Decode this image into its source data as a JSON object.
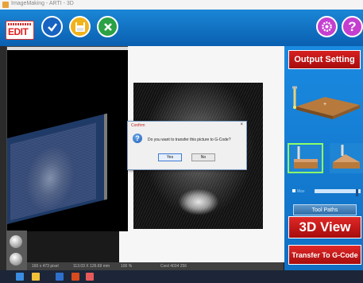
{
  "window": {
    "title": "ImageMaking - ARTI - 3D"
  },
  "toolbar": {
    "edit_label": "EDIT",
    "ok_icon": "checkmark-icon",
    "save_icon": "save-icon",
    "cancel_icon": "close-icon",
    "settings_icon": "gear-icon",
    "help_label": "?"
  },
  "sidebar": {
    "output_setting_label": "Output Setting",
    "range_label": "Max",
    "tool_paths_label": "Tool Paths",
    "view3d_label": "3D View",
    "transfer_label": "Transfer To G-Code"
  },
  "dialog": {
    "title": "Confirm",
    "close": "×",
    "message": "Do you want to transfer this picture to G-Code?",
    "yes_label": "Yes",
    "no_label": "No"
  },
  "status": {
    "size": "160 x 473 pixel",
    "dims": "113.03 X 126.69 mm",
    "zoom": "100 %",
    "coords": "Cord 4034 256"
  },
  "colors": {
    "toolbar_blue": "#0f6fc4",
    "accent_red": "#c41414",
    "selection_green": "#8cff6a"
  }
}
